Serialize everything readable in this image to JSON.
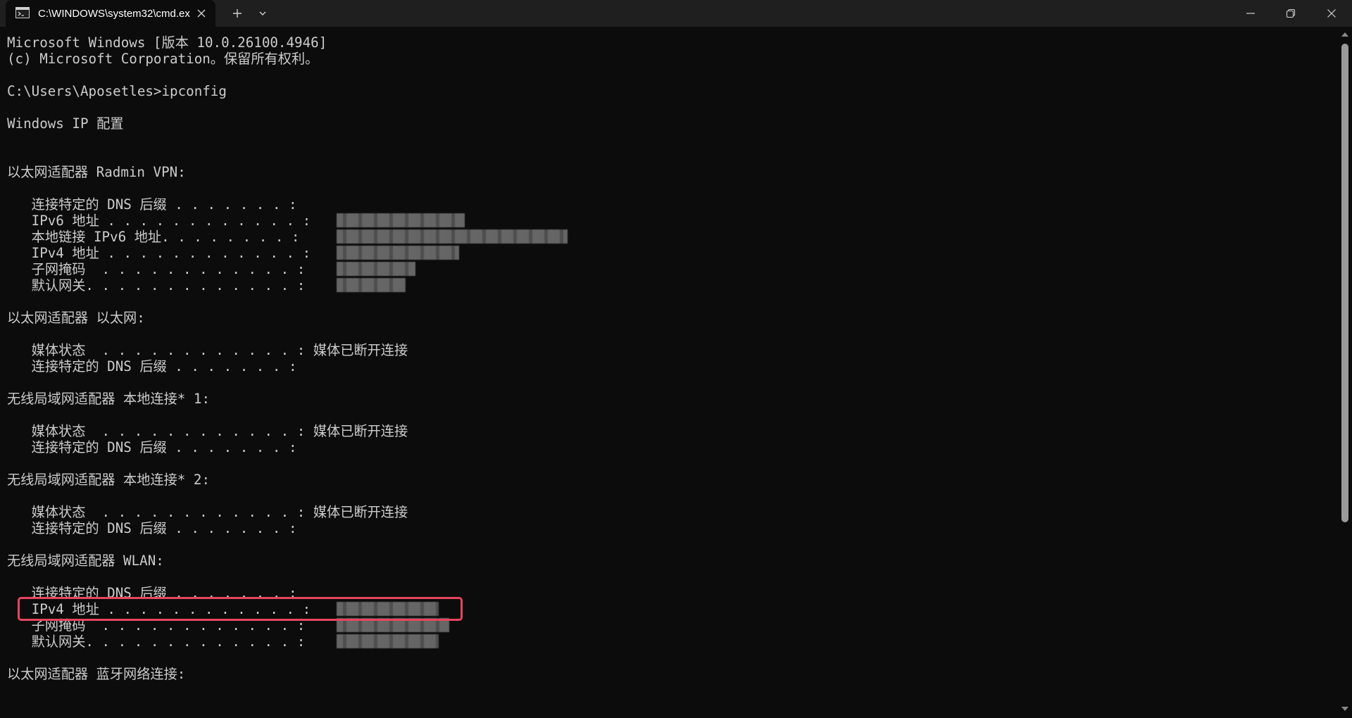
{
  "window": {
    "tab_title": "C:\\WINDOWS\\system32\\cmd.exe",
    "icons": {
      "tab": "terminal-icon",
      "close": "close-icon",
      "new_tab": "plus-icon",
      "dropdown": "chevron-down-icon",
      "minimize": "minimize-icon",
      "maximize": "restore-icon",
      "window_close": "close-icon"
    }
  },
  "terminal": {
    "lines": [
      "Microsoft Windows [版本 10.0.26100.4946]",
      "(c) Microsoft Corporation。保留所有权利。",
      "",
      "C:\\Users\\Aposetles>ipconfig",
      "",
      "Windows IP 配置",
      "",
      "",
      "以太网适配器 Radmin VPN:",
      "",
      "   连接特定的 DNS 后缀 . . . . . . . :",
      "   IPv6 地址 . . . . . . . . . . . . :",
      "   本地链接 IPv6 地址. . . . . . . . :",
      "   IPv4 地址 . . . . . . . . . . . . :",
      "   子网掩码  . . . . . . . . . . . . :",
      "   默认网关. . . . . . . . . . . . . :",
      "",
      "以太网适配器 以太网:",
      "",
      "   媒体状态  . . . . . . . . . . . . : 媒体已断开连接",
      "   连接特定的 DNS 后缀 . . . . . . . :",
      "",
      "无线局域网适配器 本地连接* 1:",
      "",
      "   媒体状态  . . . . . . . . . . . . : 媒体已断开连接",
      "   连接特定的 DNS 后缀 . . . . . . . :",
      "",
      "无线局域网适配器 本地连接* 2:",
      "",
      "   媒体状态  . . . . . . . . . . . . : 媒体已断开连接",
      "   连接特定的 DNS 后缀 . . . . . . . :",
      "",
      "无线局域网适配器 WLAN:",
      "",
      "   连接特定的 DNS 后缀 . . . . . . . :",
      "   IPv4 地址 . . . . . . . . . . . . :",
      "   子网掩码  . . . . . . . . . . . . :",
      "   默认网关. . . . . . . . . . . . . :",
      "",
      "以太网适配器 蓝牙网络连接:"
    ],
    "highlighted_line": "   IPv4 地址 . . . . . . . . . . . . :",
    "colors": {
      "background": "#0c0c0c",
      "text": "#cccccc",
      "highlight": "#e8455c"
    }
  }
}
